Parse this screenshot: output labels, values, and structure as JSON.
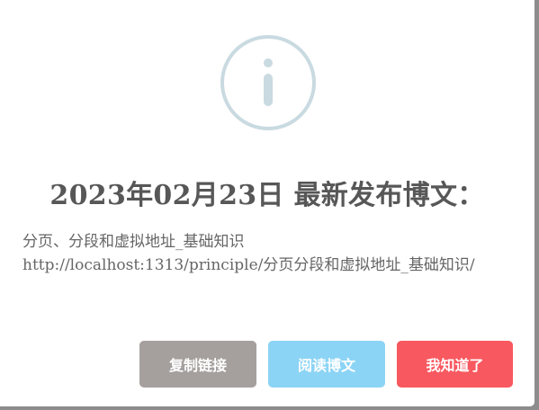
{
  "dialog": {
    "icon": "info-circle-icon",
    "title": "2023年02月23日 最新发布博文：",
    "content_line1": "分页、分段和虚拟地址_基础知识",
    "content_line2": "http://localhost:1313/principle/分页分段和虚拟地址_基础知识/",
    "buttons": {
      "copy_label": "复制链接",
      "read_label": "阅读博文",
      "ok_label": "我知道了"
    },
    "colors": {
      "icon": "#c9dae1",
      "copy_button": "#a5a09e",
      "read_button": "#8cd4f5",
      "ok_button": "#f8585f"
    }
  }
}
